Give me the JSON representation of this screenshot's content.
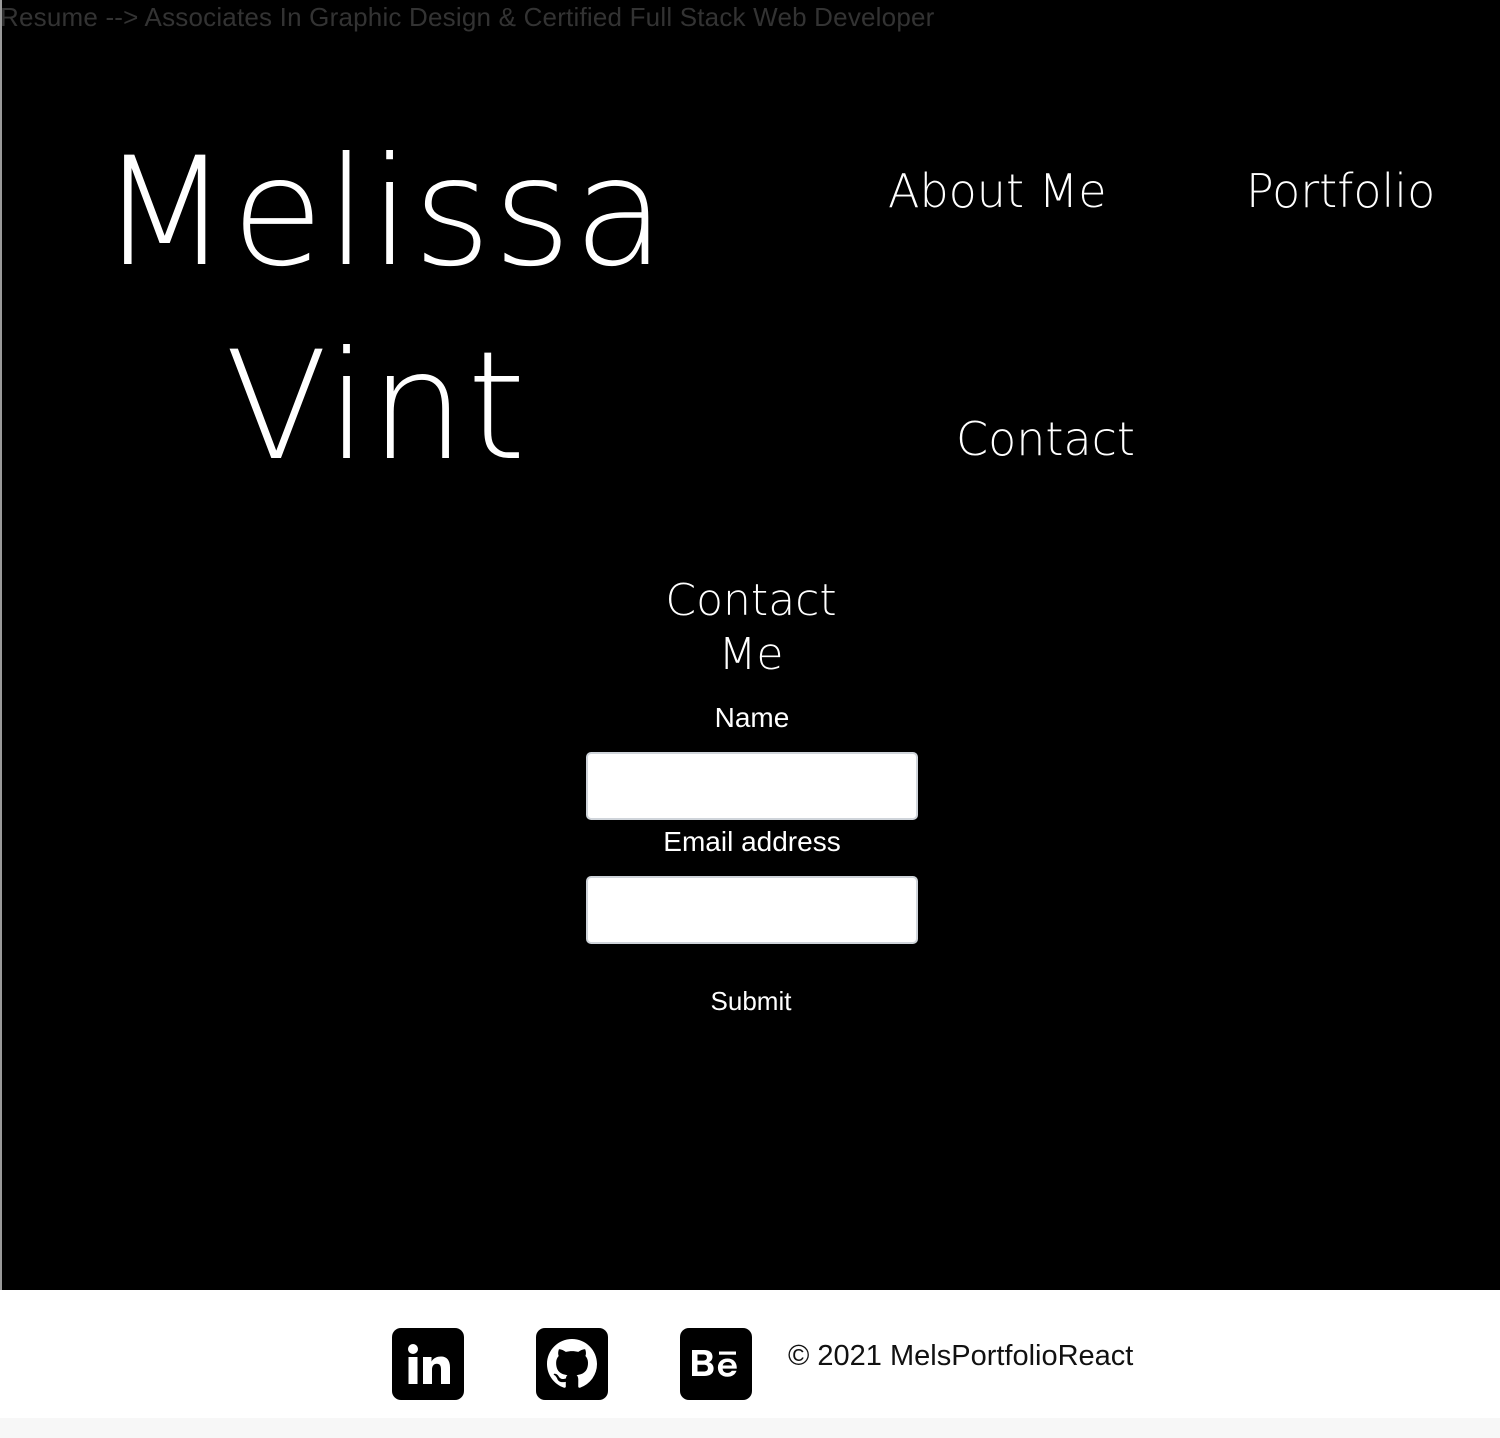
{
  "header": {
    "resume_link": "Resume --> Associates In Graphic Design & Certified Full Stack Web Developer"
  },
  "hero": {
    "first_name": "Melissa",
    "last_name": "Vint"
  },
  "nav": {
    "about": "About Me",
    "portfolio": "Portfolio",
    "contact": "Contact"
  },
  "contact_form": {
    "title_line1": "Contact",
    "title_line2": "Me",
    "name_label": "Name",
    "name_value": "",
    "email_label": "Email address",
    "email_value": "",
    "submit_label": "Submit"
  },
  "footer": {
    "icons": [
      "linkedin-icon",
      "github-icon",
      "behance-icon"
    ],
    "copyright": "© 2021 MelsPortfolioReact"
  },
  "colors": {
    "background": "#000000",
    "text": "#ffffff",
    "footer_background": "#ffffff"
  }
}
